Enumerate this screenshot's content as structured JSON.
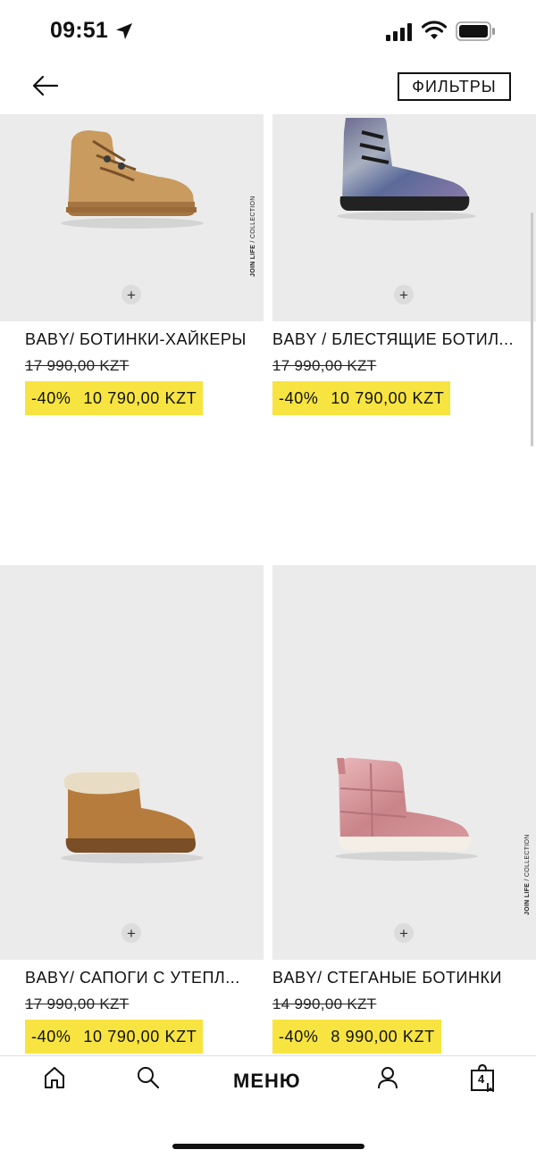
{
  "status_bar": {
    "time": "09:51"
  },
  "nav": {
    "filters_label": "ФИЛЬТРЫ"
  },
  "products": [
    {
      "name": "BABY/ БОТИНКИ-ХАЙКЕРЫ",
      "old_price": "17 990,00 KZT",
      "discount": "-40%",
      "price": "10 790,00 KZT",
      "badge_bold": "JOIN LIFE",
      "badge_rest": " / COLLECTION"
    },
    {
      "name": "BABY / БЛЕСТЯЩИЕ БОТИЛ...",
      "old_price": "17 990,00 KZT",
      "discount": "-40%",
      "price": "10 790,00 KZT"
    },
    {
      "name": "BABY/ САПОГИ С УТЕПЛ...",
      "old_price": "17 990,00 KZT",
      "discount": "-40%",
      "price": "10 790,00 KZT"
    },
    {
      "name": "BABY/ СТЕГАНЫЕ БОТИНКИ",
      "old_price": "14 990,00 KZT",
      "discount": "-40%",
      "price": "8 990,00 KZT",
      "badge_bold": "JOIN LIFE",
      "badge_rest": " / COLLECTION"
    }
  ],
  "bottom_nav": {
    "menu_label": "МЕНЮ",
    "cart_count": "4"
  },
  "colors": {
    "sale_highlight": "#f7e440",
    "image_bg": "#ebebeb"
  }
}
